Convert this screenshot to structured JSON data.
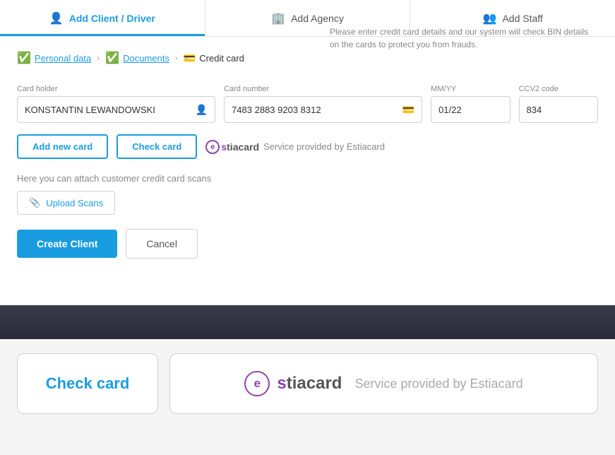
{
  "nav": {
    "items": [
      {
        "id": "add-client",
        "label": "Add Client / Driver",
        "icon": "👤",
        "active": true
      },
      {
        "id": "add-agency",
        "label": "Add Agency",
        "icon": "🏢",
        "active": false
      },
      {
        "id": "add-staff",
        "label": "Add Staff",
        "icon": "👥",
        "active": false
      }
    ]
  },
  "steps": [
    {
      "id": "personal",
      "label": "Personal data",
      "completed": true
    },
    {
      "id": "documents",
      "label": "Documents",
      "completed": true
    },
    {
      "id": "credit",
      "label": "Credit card",
      "active": true
    }
  ],
  "info_text": "Please enter credit card details and our system will check BIN details on the cards to protect you from frauds.",
  "form": {
    "card_holder_label": "Card holder",
    "card_holder_value": "KONSTANTIN LEWANDOWSKI",
    "card_number_label": "Card number",
    "card_number_value": "7483 2883 9203 8312",
    "expiry_label": "MM/YY",
    "expiry_value": "01/22",
    "ccv_label": "CCV2 code",
    "ccv_value": "834"
  },
  "buttons": {
    "add_new_card": "Add new card",
    "check_card": "Check card",
    "upload_scans": "Upload Scans",
    "create_client": "Create Client",
    "cancel": "Cancel"
  },
  "estiacard": {
    "letter": "e",
    "name_prefix": "stiacard",
    "service_text": "Service provided by Estiacard"
  },
  "upload": {
    "label": "Here you can attach customer credit card scans"
  },
  "bottom": {
    "check_card_label": "Check card",
    "estia_letter": "e",
    "estia_name": "stiacard",
    "service_text": "Service provided by Estiacard"
  }
}
